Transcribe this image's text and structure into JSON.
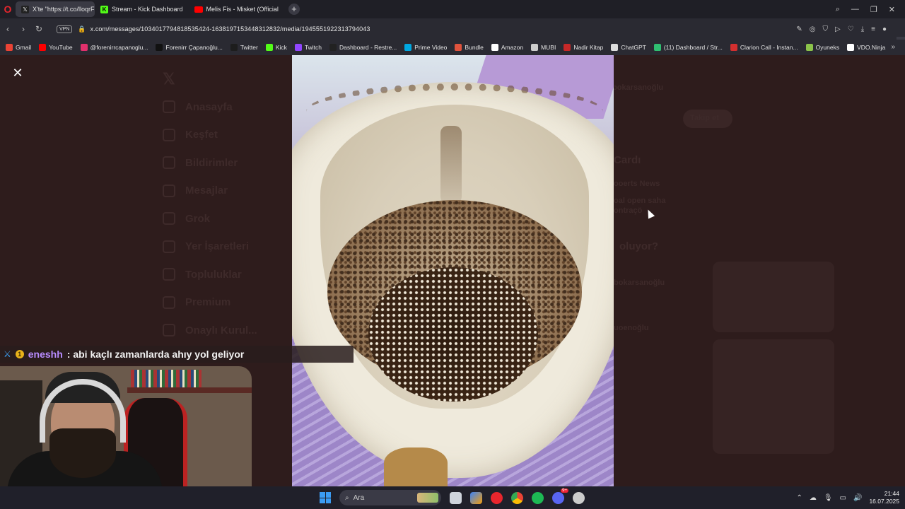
{
  "browser": {
    "tabs": [
      {
        "title": "X'te \"https://t.co/lloqrFr",
        "icon": "x-icon",
        "active": true
      },
      {
        "title": "Stream - Kick Dashboard",
        "icon": "kick-icon",
        "active": false
      },
      {
        "title": "Melis Fis - Misket (Official",
        "icon": "youtube-icon",
        "active": false
      }
    ],
    "new_tab": "+",
    "url": "x.com/messages/1034017794818535424-1638197153448312832/media/1945551922313794043",
    "vpn_label": "VPN",
    "bookmarks": [
      {
        "label": "Gmail",
        "color": "#ea4335"
      },
      {
        "label": "YouTube",
        "color": "#ff0000"
      },
      {
        "label": "@forenirrcapanoglu...",
        "color": "#e1306c"
      },
      {
        "label": "Forenirr Çapanoğlu...",
        "color": "#111111"
      },
      {
        "label": "Twitter",
        "color": "#1d1d1d"
      },
      {
        "label": "Kick",
        "color": "#53fc18"
      },
      {
        "label": "Twitch",
        "color": "#9146ff"
      },
      {
        "label": "Dashboard - Restre...",
        "color": "#222222"
      },
      {
        "label": "Prime Video",
        "color": "#00a8e1"
      },
      {
        "label": "Bundle",
        "color": "#e0533d"
      },
      {
        "label": "Amazon",
        "color": "#ffffff"
      },
      {
        "label": "MUBI",
        "color": "#cccccc"
      },
      {
        "label": "Nadir Kitap",
        "color": "#c62828"
      },
      {
        "label": "ChatGPT",
        "color": "#dddddd"
      },
      {
        "label": "(11) Dashboard / Str...",
        "color": "#2fbf71"
      },
      {
        "label": "Clarion Call - Instan...",
        "color": "#d32f2f"
      },
      {
        "label": "Oyuneks",
        "color": "#8bc34a"
      },
      {
        "label": "VDO.Ninja",
        "color": "#ffffff"
      }
    ]
  },
  "background_page": {
    "menu": [
      "Anasayfa",
      "Keşfet",
      "Bildirimler",
      "Mesajlar",
      "Grok",
      "Yer İşaretleri",
      "Topluluklar",
      "Premium",
      "Onaylı Kurul..."
    ],
    "right_texts": [
      "Takip et",
      "Cardı",
      "ooerts News",
      "oal open saha",
      "ontraçö",
      "oluyor?",
      "bokarsanoğlu",
      "uoenoğlu"
    ]
  },
  "chat": {
    "badge": "1",
    "username": "eneshh",
    "message": ": abi kaçlı zamanlarda ahıy yol geliyor"
  },
  "taskbar": {
    "search_label": "Ara",
    "time": "21:44",
    "date": "16.07.2025",
    "discord_badge": "9+"
  }
}
